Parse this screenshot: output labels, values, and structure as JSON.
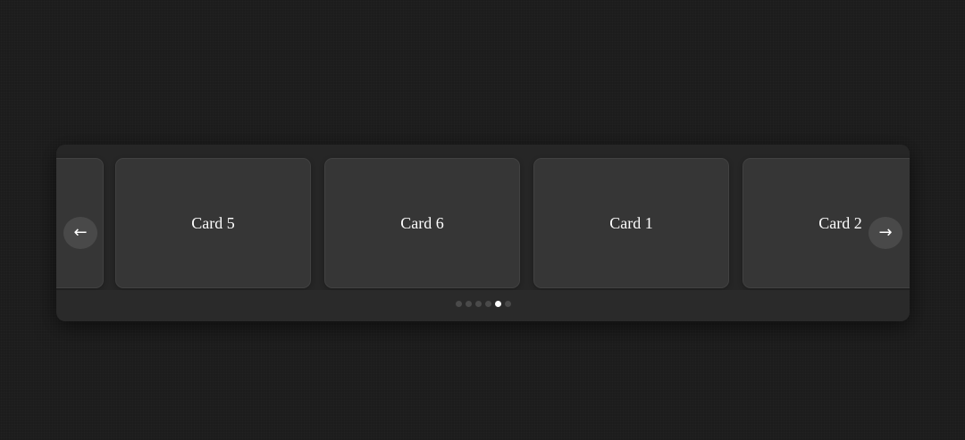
{
  "carousel": {
    "cards": [
      {
        "label": ""
      },
      {
        "label": "Card 5"
      },
      {
        "label": "Card 6"
      },
      {
        "label": "Card 1"
      },
      {
        "label": "Card 2"
      }
    ],
    "prev_label": "←",
    "next_label": "→",
    "dots": [
      {
        "active": false
      },
      {
        "active": false
      },
      {
        "active": false
      },
      {
        "active": false
      },
      {
        "active": true
      },
      {
        "active": false
      }
    ]
  },
  "colors": {
    "background": "#1c1c1c",
    "panel": "#2a2a2a",
    "card": "#363636",
    "dot": "#4a4a4a",
    "dot_active": "#ffffff"
  }
}
